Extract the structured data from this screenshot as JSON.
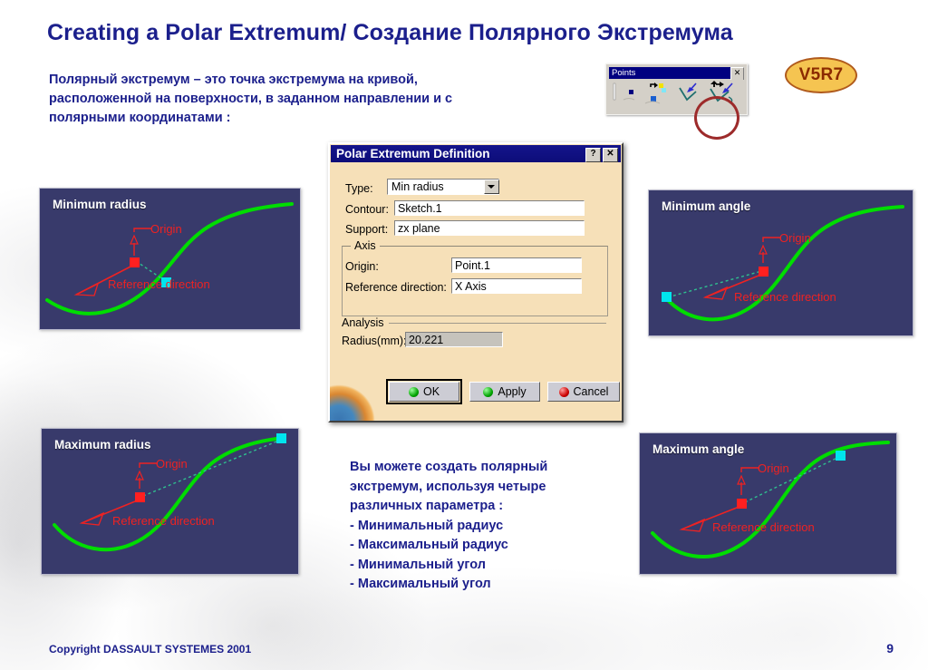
{
  "slide": {
    "title": "Creating a Polar Extremum/ Создание Полярного Экстремума",
    "intro_lines": [
      "Полярный экстремум – это точка экстремума на кривой,",
      "расположенной на поверхности, в заданном направлении и с",
      "полярными координатами :"
    ],
    "bullets_lines": [
      "Вы можете создать полярный",
      "экстремум, используя четыре",
      "различных параметра :",
      "- Минимальный радиус",
      "- Максимальный радиус",
      "- Минимальный угол",
      "- Максимальный угол"
    ],
    "version_badge": "V5R7",
    "footer_copyright": "Copyright DASSAULT SYSTEMES 2001",
    "page_number": "9",
    "colors": {
      "title_blue": "#1b1f8c",
      "viewport_bg": "#383a6b",
      "curve_green": "#00dd00",
      "annotation_red": "#ee2222",
      "origin_point_red": "#ff0000",
      "result_point_cyan": "#00e5ee",
      "badge_fill": "#f5c451",
      "badge_border": "#b05a1c",
      "dialog_bg": "#f6e0b8",
      "dialog_titlebar": "#14148c"
    }
  },
  "points_toolbar": {
    "title": "Points",
    "close_label": "✕",
    "highlight": "polar-extremum-tool-circled"
  },
  "dialog": {
    "title": "Polar Extremum Definition",
    "help_label": "?",
    "close_label": "✕",
    "fields": {
      "type_label": "Type:",
      "type_value": "Min radius",
      "contour_label": "Contour:",
      "contour_value": "Sketch.1",
      "support_label": "Support:",
      "support_value": "zx plane"
    },
    "axis_group": {
      "title": "Axis",
      "origin_label": "Origin:",
      "origin_value": "Point.1",
      "reference_direction_label": "Reference direction:",
      "reference_direction_value": "X Axis"
    },
    "analysis_group": {
      "title": "Analysis",
      "radius_label": "Radius(mm):",
      "radius_value": "20.221"
    },
    "buttons": {
      "ok": "OK",
      "apply": "Apply",
      "cancel": "Cancel"
    }
  },
  "viewports": [
    {
      "id": "min-radius",
      "label": "Minimum radius",
      "origin_label": "Origin",
      "reference_label": "Reference direction"
    },
    {
      "id": "min-angle",
      "label": "Minimum angle",
      "origin_label": "Origin",
      "reference_label": "Reference direction"
    },
    {
      "id": "max-radius",
      "label": "Maximum radius",
      "origin_label": "Origin",
      "reference_label": "Reference direction"
    },
    {
      "id": "max-angle",
      "label": "Maximum angle",
      "origin_label": "Origin",
      "reference_label": "Reference direction"
    }
  ]
}
